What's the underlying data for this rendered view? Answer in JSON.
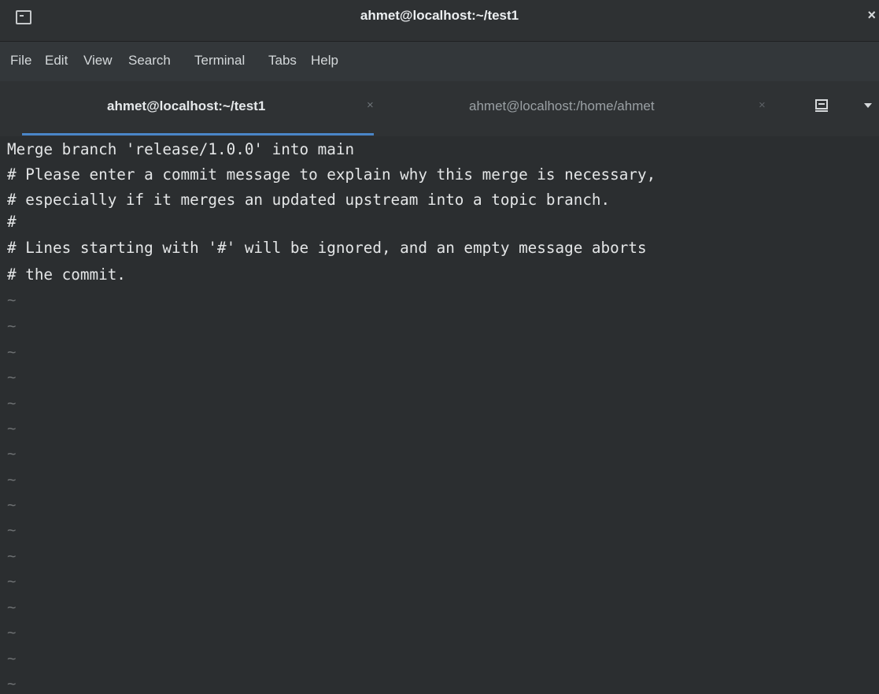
{
  "window": {
    "title": "ahmet@localhost:~/test1",
    "close_glyph": "×",
    "icon": "terminal-icon"
  },
  "menu": [
    "File",
    "Edit",
    "View",
    "Search",
    "Terminal",
    "Tabs",
    "Help"
  ],
  "tabs": [
    {
      "label": "ahmet@localhost:~/test1",
      "close": "×",
      "active": true
    },
    {
      "label": "ahmet@localhost:/home/ahmet",
      "close": "×",
      "active": false
    }
  ],
  "toolbar": {
    "new_tab_icon": "new-tab-icon",
    "dropdown_icon": "chevron-down-icon"
  },
  "editor": {
    "lines": [
      "Merge branch 'release/1.0.0' into main",
      "# Please enter a commit message to explain why this merge is necessary,",
      "# especially if it merges an updated upstream into a topic branch.",
      "#",
      "# Lines starting with '#' will be ignored, and an empty message aborts",
      "# the commit."
    ],
    "empty_line_marker": "~"
  }
}
